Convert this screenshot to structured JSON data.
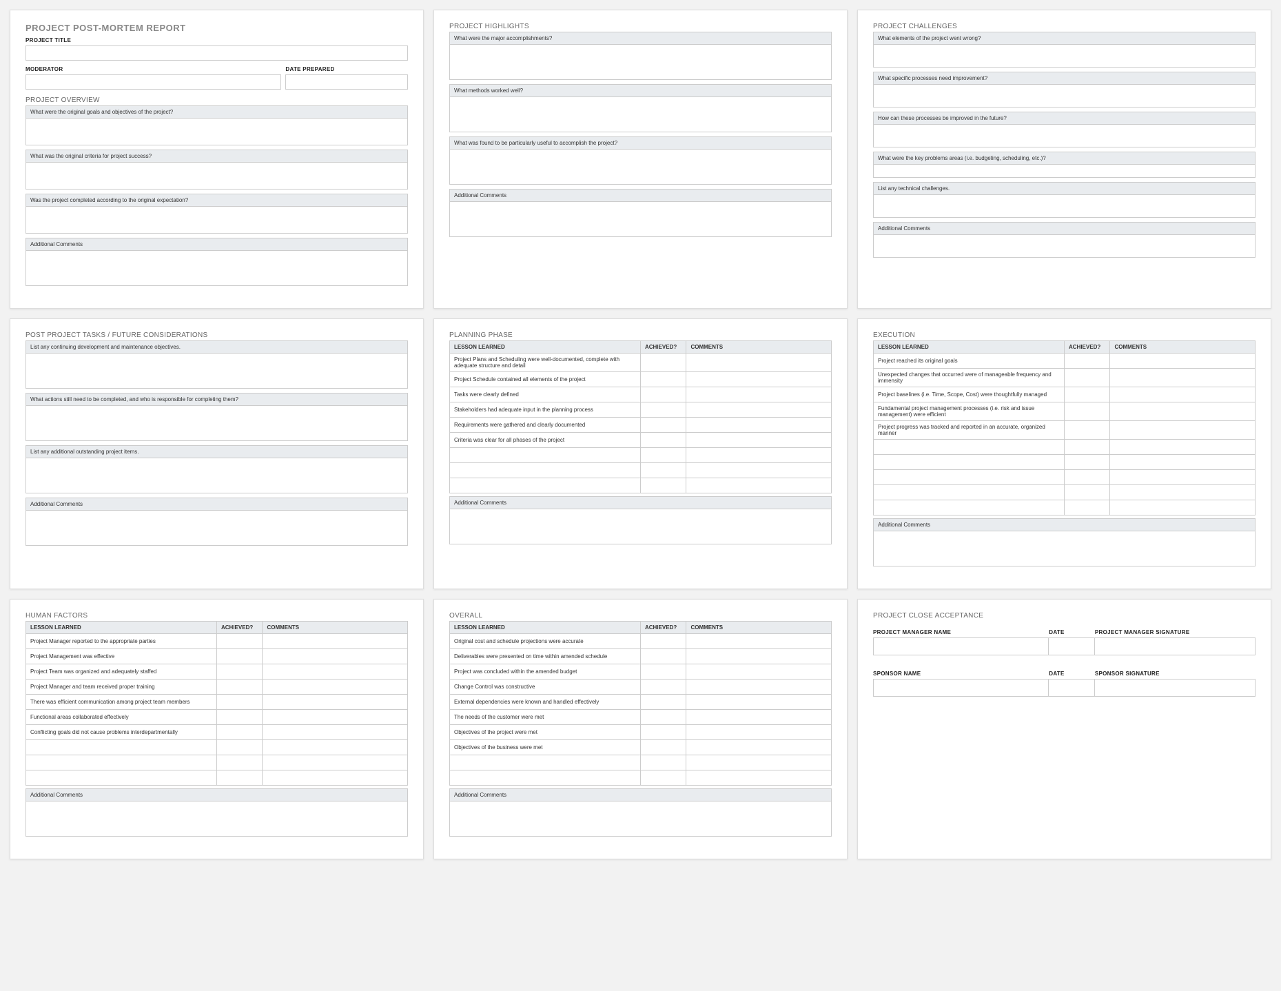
{
  "reportTitle": "PROJECT POST-MORTEM REPORT",
  "labels": {
    "projectTitle": "PROJECT TITLE",
    "moderator": "MODERATOR",
    "datePrepared": "DATE PREPARED",
    "additionalComments": "Additional Comments",
    "lessonLearned": "LESSON LEARNED",
    "achieved": "ACHIEVED?",
    "comments": "COMMENTS"
  },
  "panels": {
    "overview": {
      "section": "PROJECT OVERVIEW",
      "q1": "What were the original goals and objectives of the project?",
      "q2": "What was the original criteria for project success?",
      "q3": "Was the project completed according to the original expectation?"
    },
    "highlights": {
      "section": "PROJECT HIGHLIGHTS",
      "q1": "What were the major accomplishments?",
      "q2": "What methods worked well?",
      "q3": "What was found to be particularly useful to accomplish the project?"
    },
    "challenges": {
      "section": "PROJECT CHALLENGES",
      "q1": "What elements of the project went wrong?",
      "q2": "What specific processes need improvement?",
      "q3": "How can these processes be improved in the future?",
      "q4": "What were the key problems areas (i.e. budgeting, scheduling, etc.)?",
      "q5": "List any technical challenges."
    },
    "postTasks": {
      "section": "POST PROJECT TASKS / FUTURE CONSIDERATIONS",
      "q1": "List any continuing development and maintenance objectives.",
      "q2": "What actions still need to be completed, and who is responsible for completing them?",
      "q3": "List any additional outstanding project items."
    },
    "planning": {
      "section": "PLANNING PHASE",
      "rows": [
        "Project Plans and Scheduling were well-documented, complete with adequate structure and detail",
        "Project Schedule contained all elements of the project",
        "Tasks were clearly defined",
        "Stakeholders had adequate input in the planning process",
        "Requirements were gathered and clearly documented",
        "Criteria was clear for all phases of the project",
        "",
        "",
        ""
      ]
    },
    "execution": {
      "section": "EXECUTION",
      "rows": [
        "Project reached its original goals",
        "Unexpected changes that occurred were of manageable frequency and immensity",
        "Project baselines (i.e. Time, Scope, Cost) were thoughtfully managed",
        "Fundamental project management processes (i.e. risk and issue management) were efficient",
        "Project progress was tracked and reported in an accurate, organized manner",
        "",
        "",
        "",
        "",
        ""
      ]
    },
    "human": {
      "section": "HUMAN FACTORS",
      "rows": [
        "Project Manager reported to the appropriate parties",
        "Project Management was effective",
        "Project Team was organized and adequately staffed",
        "Project Manager and team received proper training",
        "There was efficient communication among project team members",
        "Functional areas collaborated effectively",
        "Conflicting goals did not cause problems interdepartmentally",
        "",
        "",
        ""
      ]
    },
    "overall": {
      "section": "OVERALL",
      "rows": [
        "Original cost and schedule projections were accurate",
        "Deliverables were presented on time within amended schedule",
        "Project was concluded within the amended budget",
        "Change Control was constructive",
        "External dependencies were known and handled effectively",
        "The needs of the customer were met",
        "Objectives of the project were met",
        "Objectives of the business were met",
        "",
        ""
      ]
    },
    "close": {
      "section": "PROJECT CLOSE ACCEPTANCE",
      "row1": {
        "c0": "PROJECT MANAGER NAME",
        "c1": "DATE",
        "c2": "PROJECT MANAGER SIGNATURE"
      },
      "row2": {
        "c0": "SPONSOR NAME",
        "c1": "DATE",
        "c2": "SPONSOR SIGNATURE"
      }
    }
  }
}
